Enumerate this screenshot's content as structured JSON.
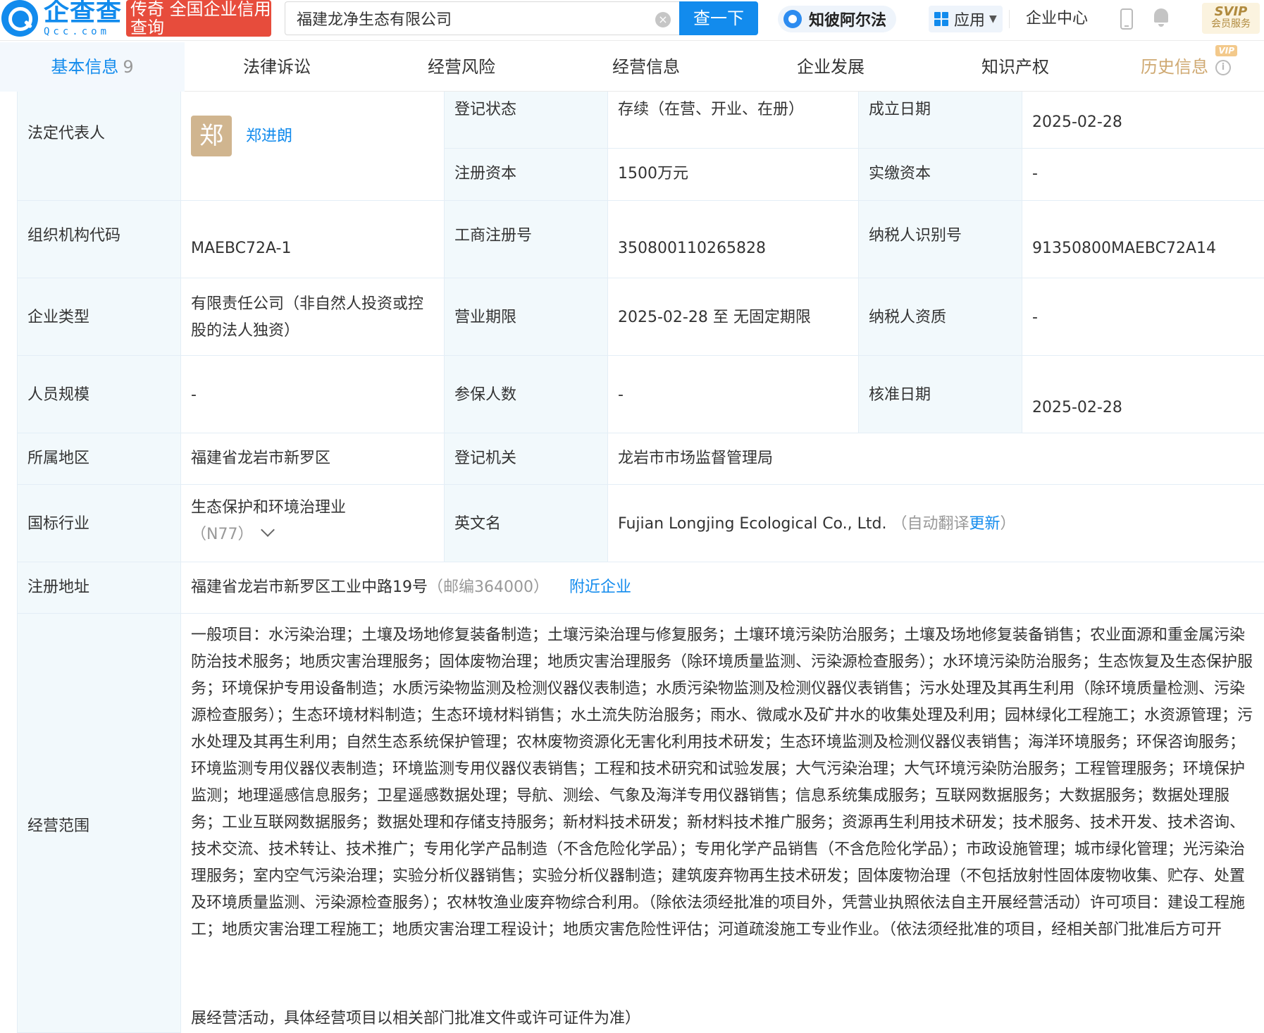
{
  "header": {
    "logo_main": "企查查",
    "logo_sub": "Qcc.com",
    "logo_badge": "传奇 全国企业信用查询",
    "search_value": "福建龙净生态有限公司",
    "search_button": "查一下",
    "zbaef_label": "知彼阿尔法",
    "apps_label": "应用",
    "company_center": "企业中心",
    "svip_top": "SVIP",
    "svip_bottom": "会员服务"
  },
  "tabs": [
    {
      "label": "基本信息",
      "count": "9"
    },
    {
      "label": "法律诉讼"
    },
    {
      "label": "经营风险"
    },
    {
      "label": "经营信息"
    },
    {
      "label": "企业发展"
    },
    {
      "label": "知识产权"
    },
    {
      "label": "历史信息",
      "badge": "VIP"
    }
  ],
  "info": {
    "legal_rep_label": "法定代表人",
    "legal_rep_avatar": "郑",
    "legal_rep_name": "郑进朗",
    "reg_status_label": "登记状态",
    "reg_status": "存续（在营、开业、在册）",
    "founded_label": "成立日期",
    "founded": "2025-02-28",
    "reg_capital_label": "注册资本",
    "reg_capital": "1500万元",
    "paid_capital_label": "实缴资本",
    "paid_capital": "-",
    "org_code_label": "组织机构代码",
    "org_code": "MAEBC72A-1",
    "biz_reg_no_label": "工商注册号",
    "biz_reg_no": "350800110265828",
    "taxpayer_id_label": "纳税人识别号",
    "taxpayer_id": "91350800MAEBC72A14",
    "company_type_label": "企业类型",
    "company_type": "有限责任公司（非自然人投资或控股的法人独资）",
    "biz_term_label": "营业期限",
    "biz_term": "2025-02-28 至 无固定期限",
    "taxpayer_qual_label": "纳税人资质",
    "taxpayer_qual": "-",
    "staff_size_label": "人员规模",
    "staff_size": "-",
    "insured_label": "参保人数",
    "insured": "-",
    "approval_date_label": "核准日期",
    "approval_date": "2025-02-28",
    "region_label": "所属地区",
    "region": "福建省龙岩市新罗区",
    "authority_label": "登记机关",
    "authority": "龙岩市市场监督管理局",
    "industry_label": "国标行业",
    "industry": "生态保护和环境治理业",
    "industry_code": "（N77）",
    "english_name_label": "英文名",
    "english_name": "Fujian Longjing Ecological Co., Ltd.",
    "auto_translate_prefix": "（自动翻译",
    "auto_translate_link": "更新",
    "auto_translate_suffix": "）",
    "address_label": "注册地址",
    "address": "福建省龙岩市新罗区工业中路19号",
    "postcode": "（邮编364000）",
    "nearby_link": "附近企业",
    "scope_label": "经营范围",
    "scope_main": "一般项目：水污染治理；土壤及场地修复装备制造；土壤污染治理与修复服务；土壤环境污染防治服务；土壤及场地修复装备销售；农业面源和重金属污染防治技术服务；地质灾害治理服务；固体废物治理；地质灾害治理服务（除环境质量监测、污染源检查服务）；水环境污染防治服务；生态恢复及生态保护服务；环境保护专用设备制造；水质污染物监测及检测仪器仪表制造；水质污染物监测及检测仪器仪表销售；污水处理及其再生利用（除环境质量检测、污染源检查服务）；生态环境材料制造；生态环境材料销售；水土流失防治服务；雨水、微咸水及矿井水的收集处理及利用；园林绿化工程施工；水资源管理；污水处理及其再生利用；自然生态系统保护管理；农林废物资源化无害化利用技术研发；生态环境监测及检测仪器仪表销售；海洋环境服务；环保咨询服务；环境监测专用仪器仪表制造；环境监测专用仪器仪表销售；工程和技术研究和试验发展；大气污染治理；大气环境污染防治服务；工程管理服务；环境保护监测；地理遥感信息服务；卫星遥感数据处理；导航、测绘、气象及海洋专用仪器销售；信息系统集成服务；互联网数据服务；大数据服务；数据处理服务；工业互联网数据服务；数据处理和存储支持服务；新材料技术研发；新材料技术推广服务；资源再生利用技术研发；技术服务、技术开发、技术咨询、技术交流、技术转让、技术推广；专用化学产品制造（不含危险化学品）；专用化学产品销售（不含危险化学品）；市政设施管理；城市绿化管理；光污染治理服务；室内空气污染治理；实验分析仪器销售；实验分析仪器制造；建筑废弃物再生技术研发；固体废物治理（不包括放射性固体废物收集、贮存、处置及环境质量监测、污染源检查服务）；农林牧渔业废弃物综合利用。（除依法须经批准的项目外，凭营业执照依法自主开展经营活动）许可项目：建设工程施工；地质灾害治理工程施工；地质灾害治理工程设计；地质灾害危险性评估；河道疏浚施工专业作业。（依法须经批准的项目，经相关部门批准后方可开",
    "scope_tail": "展经营活动，具体经营项目以相关部门批准文件或许可证件为准）"
  }
}
